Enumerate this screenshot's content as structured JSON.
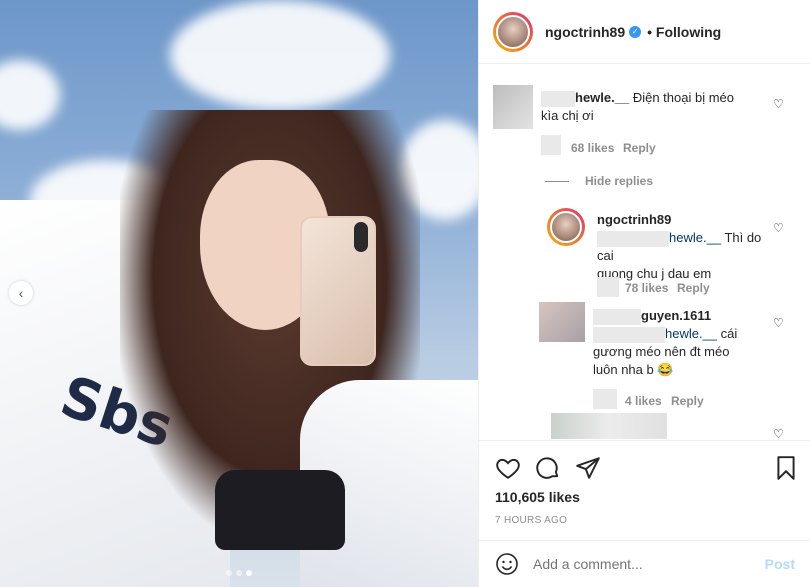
{
  "header": {
    "username": "ngoctrinh89",
    "follow_status": "• Following"
  },
  "comments": [
    {
      "user": "hewle.__",
      "text_line1": "Điện thoại bị méo",
      "text_line2": "kìa chị ơi",
      "likes": "68 likes",
      "reply": "Reply",
      "hide_replies": "Hide replies"
    },
    {
      "user": "ngoctrinh89",
      "mention": "hewle.__",
      "text_line1": "Thì do cai",
      "text_line2": "guong chu j dau em",
      "likes": "78 likes",
      "reply": "Reply"
    },
    {
      "user": "guyen.1611",
      "mention": "hewle.__",
      "text_line1": "cái",
      "text_line2": "gương méo nên đt méo",
      "text_line3": "luôn nha b 😂",
      "likes": "4 likes",
      "reply": "Reply"
    }
  ],
  "post": {
    "likes": "110,605 likes",
    "time": "7 HOURS AGO"
  },
  "composer": {
    "placeholder": "Add a comment...",
    "post_label": "Post"
  },
  "carousel": {
    "current": 3,
    "total": 3
  },
  "icons": [
    "chevron-left-icon",
    "heart-icon",
    "comment-icon",
    "share-icon",
    "bookmark-icon",
    "emoji-icon",
    "verified-icon"
  ]
}
